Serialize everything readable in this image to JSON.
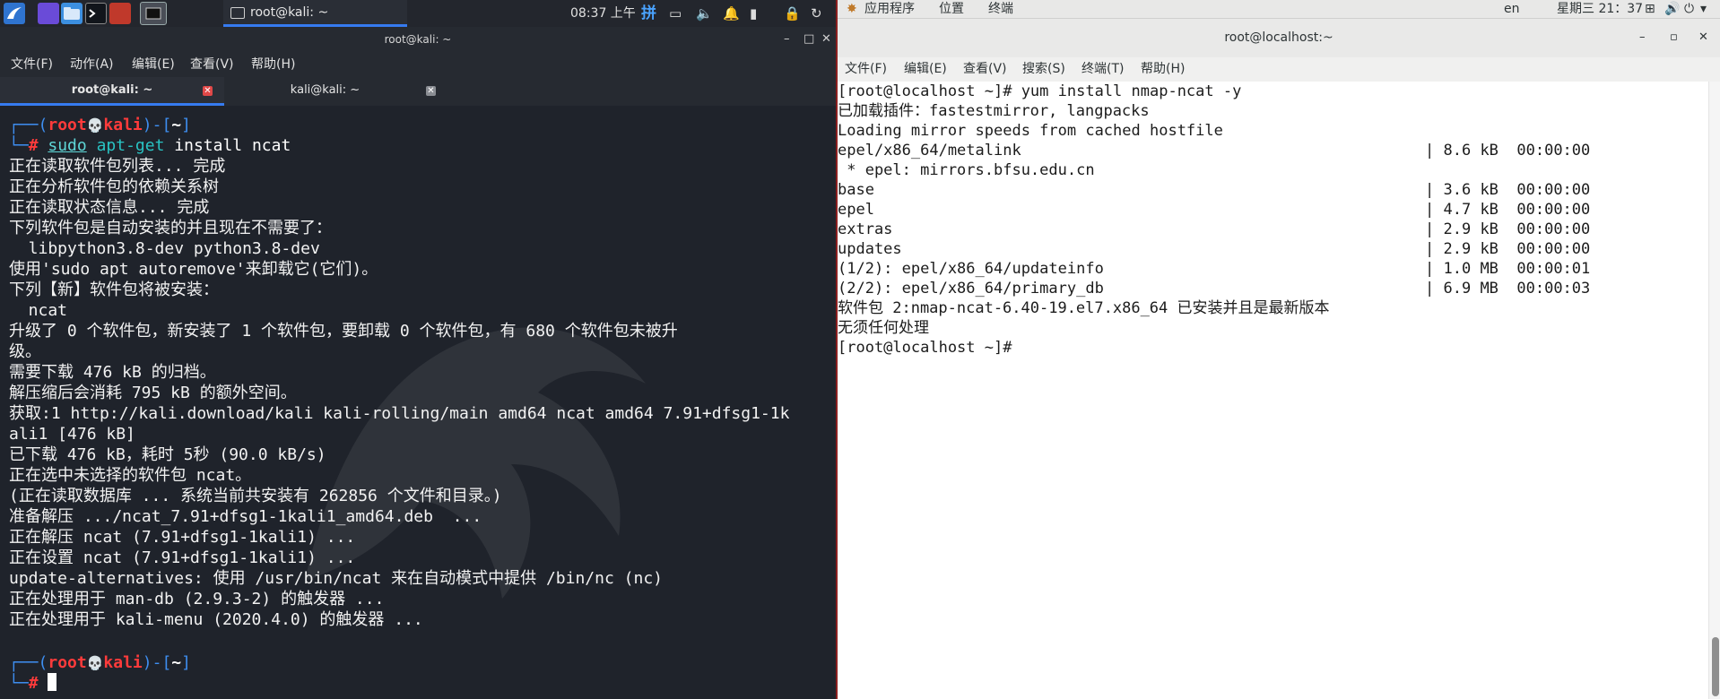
{
  "kali": {
    "taskbar": {
      "task_label": "root@kali: ~",
      "time": "08:37 上午",
      "ime": "拼"
    },
    "window_title": "root@kali: ~",
    "menu": [
      "文件(F)",
      "动作(A)",
      "编辑(E)",
      "查看(V)",
      "帮助(H)"
    ],
    "tabs": [
      {
        "label": "root@kali: ~",
        "active": true
      },
      {
        "label": "kali@kali: ~",
        "active": false
      }
    ],
    "prompt": {
      "box_open": "┌──(",
      "user": "root",
      "skull": "💀",
      "host": "kali",
      "box_mid": ")-[",
      "dir": "~",
      "box_close": "]",
      "corner": "└─",
      "hash": "#"
    },
    "command": {
      "sudo": "sudo",
      "aptget": "apt-get",
      "rest": " install ncat"
    },
    "output": [
      "正在读取软件包列表... 完成",
      "正在分析软件包的依赖关系树",
      "正在读取状态信息... 完成",
      "下列软件包是自动安装的并且现在不需要了：",
      "  libpython3.8-dev python3.8-dev",
      "使用'sudo apt autoremove'来卸载它(它们)。",
      "下列【新】软件包将被安装：",
      "  ncat",
      "升级了 0 个软件包，新安装了 1 个软件包，要卸载 0 个软件包，有 680 个软件包未被升",
      "级。",
      "需要下载 476 kB 的归档。",
      "解压缩后会消耗 795 kB 的额外空间。",
      "获取:1 http://kali.download/kali kali-rolling/main amd64 ncat amd64 7.91+dfsg1-1k",
      "ali1 [476 kB]",
      "已下载 476 kB，耗时 5秒 (90.0 kB/s)",
      "正在选中未选择的软件包 ncat。",
      "(正在读取数据库 ... 系统当前共安装有 262856 个文件和目录。)",
      "准备解压 .../ncat_7.91+dfsg1-1kali1_amd64.deb  ...",
      "正在解压 ncat (7.91+dfsg1-1kali1) ...",
      "正在设置 ncat (7.91+dfsg1-1kali1) ...",
      "update-alternatives: 使用 /usr/bin/ncat 来在自动模式中提供 /bin/nc (nc)",
      "正在处理用于 man-db (2.9.3-2) 的触发器 ...",
      "正在处理用于 kali-menu (2020.4.0) 的触发器 ..."
    ]
  },
  "centos": {
    "topbar": {
      "apps": "应用程序",
      "places": "位置",
      "terminal": "终端",
      "lang": "en",
      "clock": "星期三 21：37"
    },
    "window_title": "root@localhost:~",
    "menu": [
      "文件(F)",
      "编辑(E)",
      "查看(V)",
      "搜索(S)",
      "终端(T)",
      "帮助(H)"
    ],
    "lines": [
      "[root@localhost ~]# yum install nmap-ncat -y",
      "已加载插件：fastestmirror, langpacks",
      "Loading mirror speeds from cached hostfile",
      "epel/x86_64/metalink                                            | 8.6 kB  00:00:00",
      " * epel: mirrors.bfsu.edu.cn",
      "base                                                            | 3.6 kB  00:00:00",
      "epel                                                            | 4.7 kB  00:00:00",
      "extras                                                          | 2.9 kB  00:00:00",
      "updates                                                         | 2.9 kB  00:00:00",
      "(1/2): epel/x86_64/updateinfo                                   | 1.0 MB  00:00:01",
      "(2/2): epel/x86_64/primary_db                                   | 6.9 MB  00:00:03",
      "软件包 2:nmap-ncat-6.40-19.el7.x86_64 已安装并且是最新版本",
      "无须任何处理",
      "[root@localhost ~]#"
    ]
  }
}
